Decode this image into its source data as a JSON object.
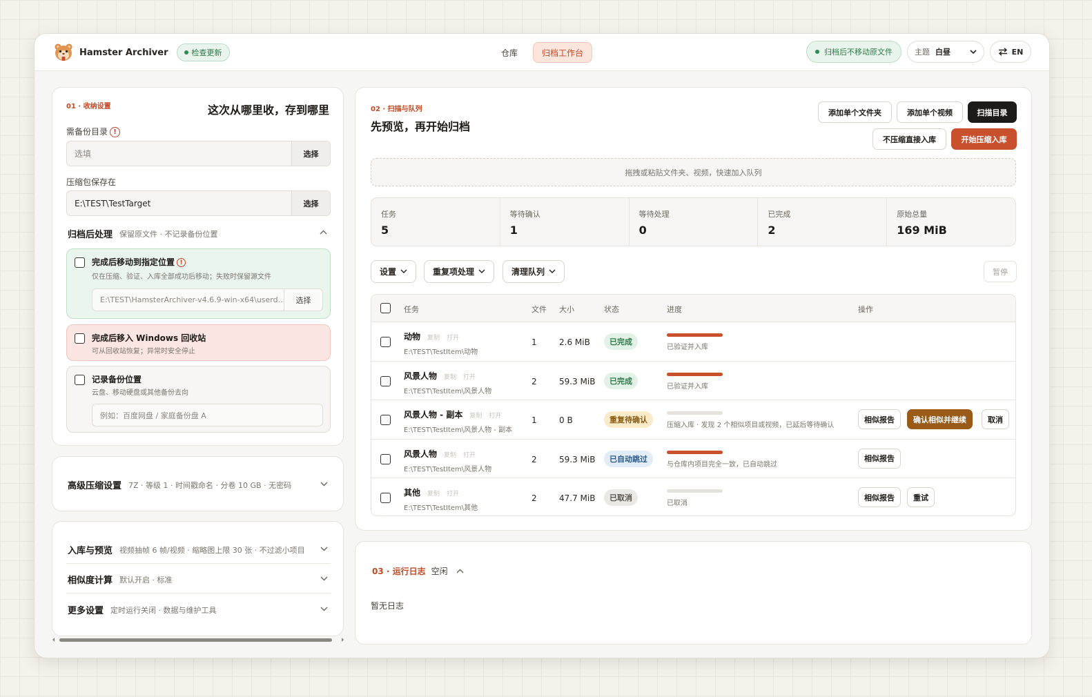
{
  "header": {
    "brand": "Hamster Archiver",
    "update_label": "检查更新",
    "tabs": [
      {
        "label": "仓库"
      },
      {
        "label": "归档工作台"
      }
    ],
    "no_move_label": "归档后不移动原文件",
    "theme_label": "主题",
    "theme_value": "白昼",
    "lang_label": "EN"
  },
  "settings": {
    "tag": "01 · 收纳设置",
    "title": "这次从哪里收，存到哪里",
    "source_label": "需备份目录",
    "source_placeholder": "选填",
    "choose": "选择",
    "target_label": "压缩包保存在",
    "target_value": "E:\\TEST\\TestTarget",
    "post_title": "归档后处理",
    "post_summary": "保留原文件 · 不记录备份位置",
    "options": [
      {
        "title": "完成后移动到指定位置",
        "desc": "仅在压缩、验证、入库全部成功后移动；失败时保留源文件",
        "path": "E:\\TEST\\HamsterArchiver-v4.6.9-win-x64\\userd...",
        "choose": "选择"
      },
      {
        "title": "完成后移入 Windows 回收站",
        "desc": "可从回收站恢复；异常时安全停止"
      },
      {
        "title": "记录备份位置",
        "desc": "云盘、移动硬盘或其他备份去向",
        "placeholder": "例如：百度网盘 / 家庭备份盘 A"
      }
    ]
  },
  "advanced": {
    "title": "高级压缩设置",
    "summary": "7Z · 等级 1 · 时间戳命名 · 分卷 10 GB · 无密码"
  },
  "more_sections": [
    {
      "title": "入库与预览",
      "summary": "视频抽帧 6 帧/视频 · 缩略图上限 30 张 · 不过滤小项目"
    },
    {
      "title": "相似度计算",
      "summary": "默认开启 · 标准"
    },
    {
      "title": "更多设置",
      "summary": "定时运行关闭 · 数据与维护工具"
    }
  ],
  "queue": {
    "tag": "02 · 扫描与队列",
    "title": "先预览，再开始归档",
    "btn_add_folder": "添加单个文件夹",
    "btn_add_video": "添加单个视频",
    "btn_scan": "扫描目录",
    "btn_direct": "不压缩直接入库",
    "btn_start": "开始压缩入库",
    "dropzone": "拖拽或粘贴文件夹、视频，快速加入队列",
    "stats": [
      {
        "label": "任务",
        "value": "5"
      },
      {
        "label": "等待确认",
        "value": "1"
      },
      {
        "label": "等待处理",
        "value": "0"
      },
      {
        "label": "已完成",
        "value": "2"
      },
      {
        "label": "原始总量",
        "value": "169 MiB"
      }
    ],
    "dd_settings": "设置",
    "dd_dup": "重复项处理",
    "dd_clear": "清理队列",
    "pause": "暂停",
    "columns": {
      "task": "任务",
      "files": "文件",
      "size": "大小",
      "status": "状态",
      "progress": "进度",
      "actions": "操作"
    },
    "copy": "复制",
    "open": "打开",
    "rows": [
      {
        "name": "动物",
        "path": "E:\\TEST\\TestItem\\动物",
        "files": "1",
        "size": "2.6 MiB",
        "status": "已完成",
        "status_kind": "done",
        "progress": 1.0,
        "progress_text": "已验证并入库",
        "actions": []
      },
      {
        "name": "风景人物",
        "path": "E:\\TEST\\TestItem\\风景人物",
        "files": "2",
        "size": "59.3 MiB",
        "status": "已完成",
        "status_kind": "done",
        "progress": 1.0,
        "progress_text": "已验证并入库",
        "actions": []
      },
      {
        "name": "风景人物 - 副本",
        "path": "E:\\TEST\\TestItem\\风景人物 - 副本",
        "files": "1",
        "size": "0 B",
        "status": "重复待确认",
        "status_kind": "dup",
        "progress": 0.0,
        "progress_text": "压缩入库 · 发现 2 个相似项目或视频，已延后等待确认",
        "actions": [
          "相似报告",
          "确认相似并继续",
          "取消"
        ]
      },
      {
        "name": "风景人物",
        "path": "E:\\TEST\\TestItem\\风景人物",
        "files": "2",
        "size": "59.3 MiB",
        "status": "已自动跳过",
        "status_kind": "skip",
        "progress": 1.0,
        "progress_text": "与仓库内项目完全一致，已自动跳过",
        "actions": [
          "相似报告"
        ]
      },
      {
        "name": "其他",
        "path": "E:\\TEST\\TestItem\\其他",
        "files": "2",
        "size": "47.7 MiB",
        "status": "已取消",
        "status_kind": "cancel",
        "progress": 0.0,
        "progress_text": "已取消",
        "actions": [
          "相似报告",
          "重试"
        ]
      }
    ]
  },
  "log": {
    "tag": "03 · 运行日志",
    "state": "空闲",
    "empty": "暂无日志"
  }
}
